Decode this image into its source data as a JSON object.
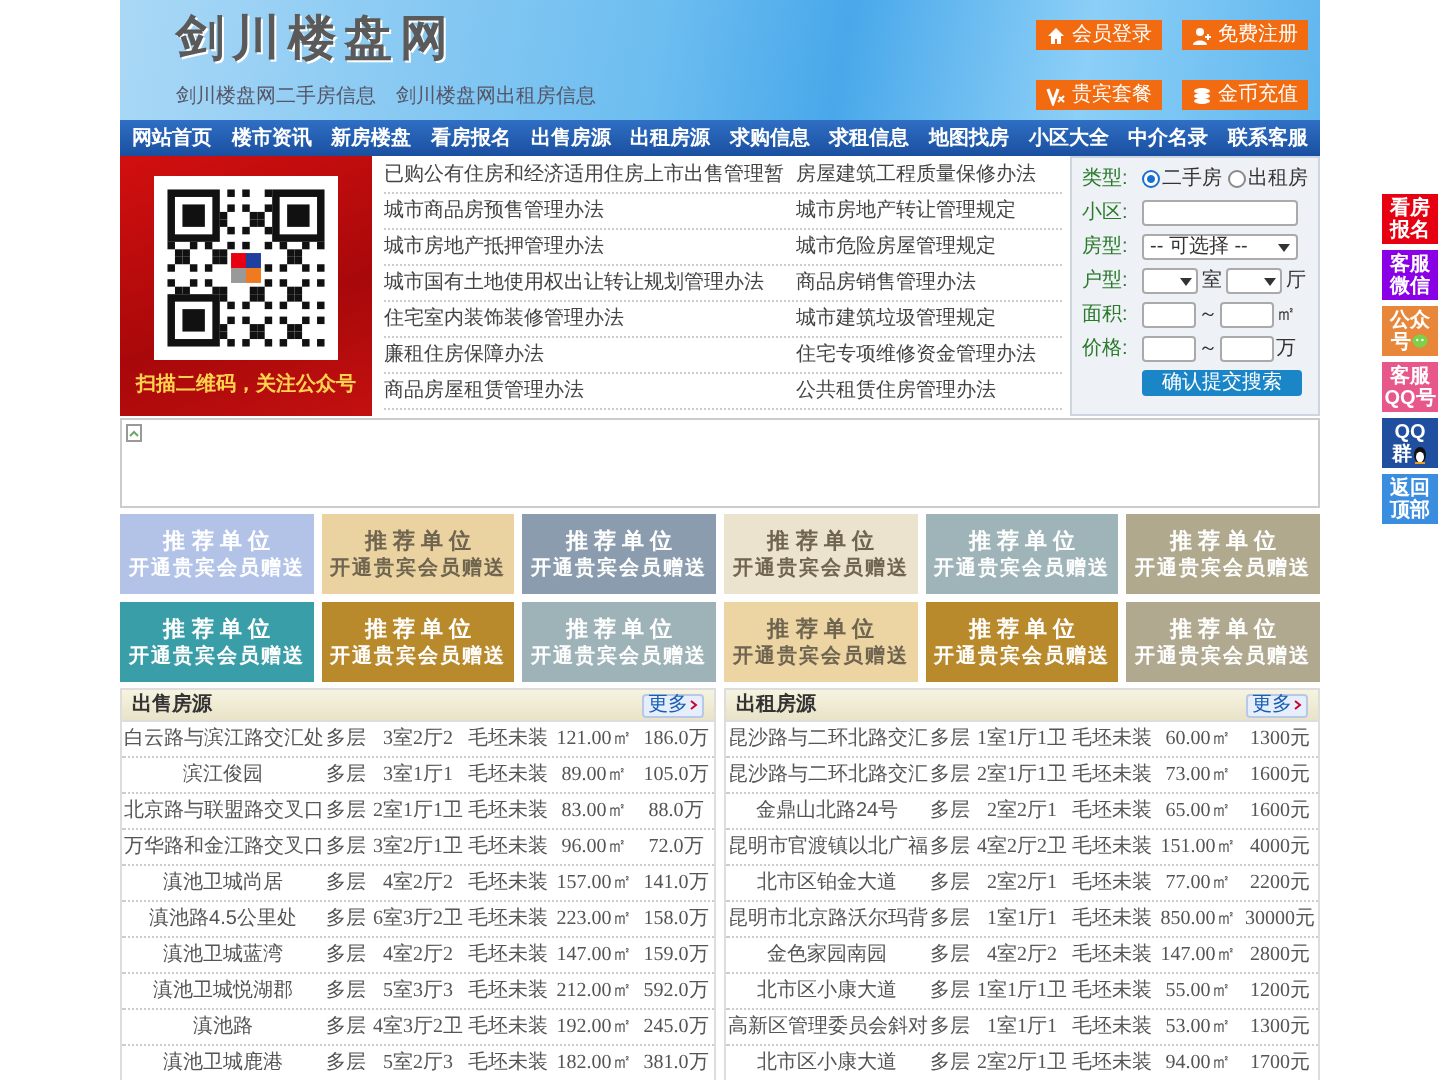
{
  "header": {
    "title": "剑川楼盘网",
    "sub_links": [
      "剑川楼盘网二手房信息",
      "剑川楼盘网出租房信息"
    ],
    "buttons": [
      {
        "label": "会员登录",
        "kind": "home"
      },
      {
        "label": "免费注册",
        "kind": "user"
      },
      {
        "label": "贵宾套餐",
        "kind": "vip"
      },
      {
        "label": "金币充值",
        "kind": "coins"
      }
    ]
  },
  "nav": [
    "网站首页",
    "楼市资讯",
    "新房楼盘",
    "看房报名",
    "出售房源",
    "出租房源",
    "求购信息",
    "求租信息",
    "地图找房",
    "小区大全",
    "中介名录",
    "联系客服"
  ],
  "promo": {
    "caption": "扫描二维码，关注公众号"
  },
  "article_rows": [
    {
      "left": "已购公有住房和经济适用住房上市出售管理暂",
      "right": "房屋建筑工程质量保修办法"
    },
    {
      "left": "城市商品房预售管理办法",
      "right": "城市房地产转让管理规定"
    },
    {
      "left": "城市房地产抵押管理办法",
      "right": "城市危险房屋管理规定"
    },
    {
      "left": "城市国有土地使用权出让转让规划管理办法",
      "right": "商品房销售管理办法"
    },
    {
      "left": "住宅室内装饰装修管理办法",
      "right": "城市建筑垃圾管理规定"
    },
    {
      "left": "廉租住房保障办法",
      "right": "住宅专项维修资金管理办法"
    },
    {
      "left": "商品房屋租赁管理办法",
      "right": "公共租赁住房管理办法"
    }
  ],
  "search": {
    "fields": [
      {
        "kind": "radio",
        "label": "类型:",
        "options": [
          {
            "label": "二手房",
            "selected": true
          },
          {
            "label": "出租房",
            "selected": false
          }
        ]
      },
      {
        "kind": "text",
        "label": "小区:"
      },
      {
        "kind": "select",
        "label": "房型:",
        "value": "-- 可选择 --"
      },
      {
        "kind": "pair_select",
        "label": "户型:",
        "units": [
          "室",
          "厅"
        ]
      },
      {
        "kind": "range",
        "label": "面积:",
        "separator": "～",
        "unit": "㎡"
      },
      {
        "kind": "range",
        "label": "价格:",
        "separator": "～",
        "unit": "万"
      }
    ],
    "submit": "确认提交搜索"
  },
  "ads": [
    {
      "title": "推 荐 单 位",
      "subtitle": "开通贵宾会员赠送",
      "color": "#b3c3e8"
    },
    {
      "title": "推 荐 单 位",
      "subtitle": "开通贵宾会员赠送",
      "color": "#ead3a0"
    },
    {
      "title": "推 荐 单 位",
      "subtitle": "开通贵宾会员赠送",
      "color": "#8a9cad"
    },
    {
      "title": "推 荐 单 位",
      "subtitle": "开通贵宾会员赠送",
      "color": "#ece3cf"
    },
    {
      "title": "推 荐 单 位",
      "subtitle": "开通贵宾会员赠送",
      "color": "#9eb4b9"
    },
    {
      "title": "推 荐 单 位",
      "subtitle": "开通贵宾会员赠送",
      "color": "#b0a98e"
    },
    {
      "title": "推 荐 单 位",
      "subtitle": "开通贵宾会员赠送",
      "color": "#3a9ea8"
    },
    {
      "title": "推 荐 单 位",
      "subtitle": "开通贵宾会员赠送",
      "color": "#b98a2b"
    },
    {
      "title": "推 荐 单 位",
      "subtitle": "开通贵宾会员赠送",
      "color": "#9db3b8"
    },
    {
      "title": "推 荐 单 位",
      "subtitle": "开通贵宾会员赠送",
      "color": "#edd5a3"
    },
    {
      "title": "推 荐 单 位",
      "subtitle": "开通贵宾会员赠送",
      "color": "#b98a2c"
    },
    {
      "title": "推 荐 单 位",
      "subtitle": "开通贵宾会员赠送",
      "color": "#b0a98f"
    }
  ],
  "sale": {
    "title": "出售房源",
    "more": "更多",
    "rows": [
      [
        "白云路与滨江路交汇处",
        "多层",
        "3室2厅2",
        "毛坯未装",
        "121.00㎡",
        "186.0万"
      ],
      [
        "滨江俊园",
        "多层",
        "3室1厅1",
        "毛坯未装",
        "89.00㎡",
        "105.0万"
      ],
      [
        "北京路与联盟路交叉口",
        "多层",
        "2室1厅1卫",
        "毛坯未装",
        "83.00㎡",
        "88.0万"
      ],
      [
        "万华路和金江路交叉口",
        "多层",
        "3室2厅1卫",
        "毛坯未装",
        "96.00㎡",
        "72.0万"
      ],
      [
        "滇池卫城尚居",
        "多层",
        "4室2厅2",
        "毛坯未装",
        "157.00㎡",
        "141.0万"
      ],
      [
        "滇池路4.5公里处",
        "多层",
        "6室3厅2卫",
        "毛坯未装",
        "223.00㎡",
        "158.0万"
      ],
      [
        "滇池卫城蓝湾",
        "多层",
        "4室2厅2",
        "毛坯未装",
        "147.00㎡",
        "159.0万"
      ],
      [
        "滇池卫城悦湖郡",
        "多层",
        "5室3厅3",
        "毛坯未装",
        "212.00㎡",
        "592.0万"
      ],
      [
        "滇池路",
        "多层",
        "4室3厅2卫",
        "毛坯未装",
        "192.00㎡",
        "245.0万"
      ],
      [
        "滇池卫城鹿港",
        "多层",
        "5室2厅3",
        "毛坯未装",
        "182.00㎡",
        "381.0万"
      ]
    ]
  },
  "rent": {
    "title": "出租房源",
    "more": "更多",
    "rows": [
      [
        "昆沙路与二环北路交汇",
        "多层",
        "1室1厅1卫",
        "毛坯未装",
        "60.00㎡",
        "1300元"
      ],
      [
        "昆沙路与二环北路交汇",
        "多层",
        "2室1厅1卫",
        "毛坯未装",
        "73.00㎡",
        "1600元"
      ],
      [
        "金鼎山北路24号",
        "多层",
        "2室2厅1",
        "毛坯未装",
        "65.00㎡",
        "1600元"
      ],
      [
        "昆明市官渡镇以北广福",
        "多层",
        "4室2厅2卫",
        "毛坯未装",
        "151.00㎡",
        "4000元"
      ],
      [
        "北市区铂金大道",
        "多层",
        "2室2厅1",
        "毛坯未装",
        "77.00㎡",
        "2200元"
      ],
      [
        "昆明市北京路沃尔玛背",
        "多层",
        "1室1厅1",
        "毛坯未装",
        "850.00㎡",
        "30000元"
      ],
      [
        "金色家园南园",
        "多层",
        "4室2厅2",
        "毛坯未装",
        "147.00㎡",
        "2800元"
      ],
      [
        "北市区小康大道",
        "多层",
        "1室1厅1卫",
        "毛坯未装",
        "55.00㎡",
        "1200元"
      ],
      [
        "高新区管理委员会斜对",
        "多层",
        "1室1厅1",
        "毛坯未装",
        "53.00㎡",
        "1300元"
      ],
      [
        "北市区小康大道",
        "多层",
        "2室2厅1卫",
        "毛坯未装",
        "94.00㎡",
        "1700元"
      ]
    ]
  },
  "side_buttons": [
    {
      "lines": [
        "看房",
        "报名"
      ],
      "color": "#e60012",
      "kind": "plain"
    },
    {
      "lines": [
        "客服",
        "微信"
      ],
      "color": "#8a00e6",
      "kind": "plain"
    },
    {
      "lines": [
        "公众",
        "号"
      ],
      "color": "#e8863a",
      "kind": "wechat"
    },
    {
      "lines": [
        "客服",
        "QQ号"
      ],
      "color": "#e8578a",
      "kind": "plain"
    },
    {
      "lines": [
        "QQ",
        "群"
      ],
      "color": "#1f4f9e",
      "kind": "penguin"
    },
    {
      "lines": [
        "返回",
        "顶部"
      ],
      "color": "#3b8de0",
      "kind": "plain"
    }
  ]
}
